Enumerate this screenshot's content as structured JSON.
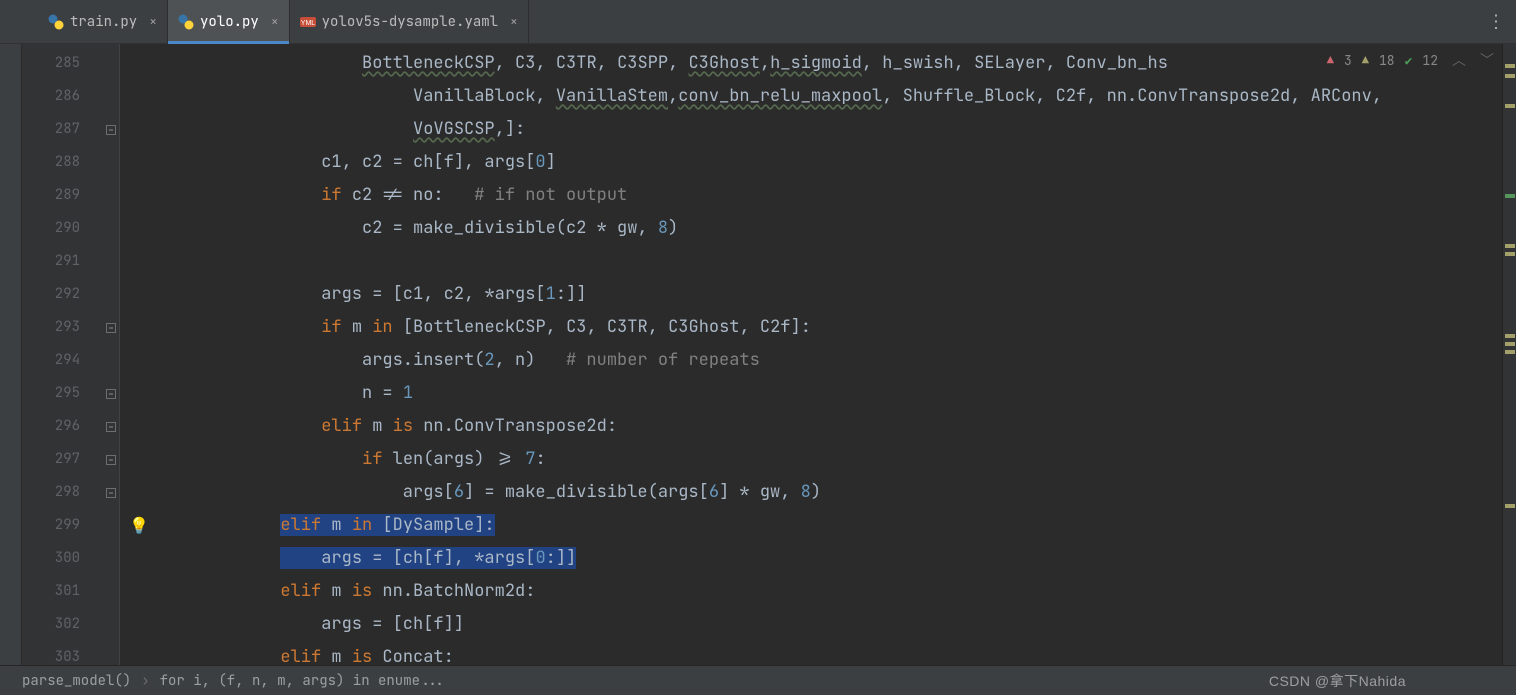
{
  "tabs": [
    {
      "label": "train.py",
      "type": "py"
    },
    {
      "label": "yolo.py",
      "type": "py"
    },
    {
      "label": "yolov5s-dysample.yaml",
      "type": "yaml"
    }
  ],
  "inspections": {
    "errors": "3",
    "warnings": "18",
    "ok": "12"
  },
  "lines_start": 285,
  "code": [
    {
      "n": 285,
      "fold": "",
      "segs": [
        [
          "        ",
          "id"
        ],
        [
          "BottleneckCSP",
          "wavy"
        ],
        [
          ", ",
          "id"
        ],
        [
          "C3",
          "id"
        ],
        [
          ", ",
          "id"
        ],
        [
          "C3TR",
          "id"
        ],
        [
          ", ",
          "id"
        ],
        [
          "C3SPP",
          "id"
        ],
        [
          ", ",
          "id"
        ],
        [
          "C3Ghost",
          "wavy"
        ],
        [
          ",",
          "id"
        ],
        [
          "h_sigmoid",
          "wavy"
        ],
        [
          ", h_swish, SELayer, Conv_bn_hs",
          "id"
        ]
      ]
    },
    {
      "n": 286,
      "fold": "",
      "segs": [
        [
          "             ",
          "id"
        ],
        [
          "VanillaBlock",
          "id"
        ],
        [
          ", ",
          "id"
        ],
        [
          "VanillaStem",
          "wavy"
        ],
        [
          ",",
          "id"
        ],
        [
          "conv_bn_relu_maxpool",
          "wavy"
        ],
        [
          ", Shuffle_Block, C2f, nn.ConvTranspose2d, ARConv, ",
          "id"
        ]
      ]
    },
    {
      "n": 287,
      "fold": "m",
      "segs": [
        [
          "             ",
          "id"
        ],
        [
          "VoVGSCSP",
          "wavy"
        ],
        [
          ",",
          "id"
        ],
        [
          "]:",
          "id"
        ]
      ]
    },
    {
      "n": 288,
      "fold": "",
      "segs": [
        [
          "    c1",
          "id"
        ],
        [
          ", ",
          "id"
        ],
        [
          "c2 = ch[f]",
          "id"
        ],
        [
          ", ",
          "id"
        ],
        [
          "args[",
          "id"
        ],
        [
          "0",
          "num"
        ],
        [
          "]",
          "id"
        ]
      ]
    },
    {
      "n": 289,
      "fold": "",
      "segs": [
        [
          "    ",
          "id"
        ],
        [
          "if ",
          "kw"
        ],
        [
          "c2 != no:   ",
          "id"
        ],
        [
          "# if not output",
          "cm"
        ]
      ]
    },
    {
      "n": 290,
      "fold": "",
      "segs": [
        [
          "        c2 = make_divisible(c2 * gw",
          "id"
        ],
        [
          ", ",
          "id"
        ],
        [
          "8",
          "num"
        ],
        [
          ")",
          "id"
        ]
      ]
    },
    {
      "n": 291,
      "fold": "",
      "segs": [
        [
          "",
          "id"
        ]
      ]
    },
    {
      "n": 292,
      "fold": "",
      "segs": [
        [
          "    args = [c1",
          "id"
        ],
        [
          ", ",
          "id"
        ],
        [
          "c2",
          "id"
        ],
        [
          ", ",
          "id"
        ],
        [
          "*args[",
          "id"
        ],
        [
          "1",
          "num"
        ],
        [
          ":]]",
          "id"
        ]
      ]
    },
    {
      "n": 293,
      "fold": "m",
      "segs": [
        [
          "    ",
          "id"
        ],
        [
          "if ",
          "kw"
        ],
        [
          "m ",
          "id"
        ],
        [
          "in ",
          "kw"
        ],
        [
          "[BottleneckCSP",
          "id"
        ],
        [
          ", ",
          "id"
        ],
        [
          "C3",
          "id"
        ],
        [
          ", ",
          "id"
        ],
        [
          "C3TR",
          "id"
        ],
        [
          ", ",
          "id"
        ],
        [
          "C3Ghost",
          "id"
        ],
        [
          ", ",
          "id"
        ],
        [
          "C2f]:",
          "id"
        ]
      ]
    },
    {
      "n": 294,
      "fold": "",
      "segs": [
        [
          "        args.insert(",
          "id"
        ],
        [
          "2",
          "num"
        ],
        [
          ", ",
          "id"
        ],
        [
          "n)   ",
          "id"
        ],
        [
          "# number of repeats",
          "cm"
        ]
      ]
    },
    {
      "n": 295,
      "fold": "m",
      "segs": [
        [
          "        n = ",
          "id"
        ],
        [
          "1",
          "num"
        ]
      ]
    },
    {
      "n": 296,
      "fold": "m",
      "segs": [
        [
          "    ",
          "id"
        ],
        [
          "elif ",
          "kw"
        ],
        [
          "m ",
          "id"
        ],
        [
          "is ",
          "kw"
        ],
        [
          "nn.ConvTranspose2d:",
          "id"
        ]
      ]
    },
    {
      "n": 297,
      "fold": "m",
      "segs": [
        [
          "        ",
          "id"
        ],
        [
          "if ",
          "kw"
        ],
        [
          "len(args) >= ",
          "id"
        ],
        [
          "7",
          "num"
        ],
        [
          ":",
          "id"
        ]
      ]
    },
    {
      "n": 298,
      "fold": "m",
      "segs": [
        [
          "            args[",
          "id"
        ],
        [
          "6",
          "num"
        ],
        [
          "] = make_divisible(args[",
          "id"
        ],
        [
          "6",
          "num"
        ],
        [
          "] * gw",
          "id"
        ],
        [
          ", ",
          "id"
        ],
        [
          "8",
          "num"
        ],
        [
          ")",
          "id"
        ]
      ]
    },
    {
      "n": 299,
      "fold": "",
      "sel": true,
      "bulb": true,
      "segs": [
        [
          "",
          "id"
        ],
        [
          "elif ",
          "kw sel"
        ],
        [
          "m ",
          "id sel"
        ],
        [
          "in ",
          "kw sel"
        ],
        [
          "[DySample]:",
          "id sel"
        ]
      ]
    },
    {
      "n": 300,
      "fold": "",
      "sel": true,
      "segs": [
        [
          "    ",
          "id sel"
        ],
        [
          "args = [ch[f]",
          "id sel"
        ],
        [
          ", ",
          "id sel"
        ],
        [
          "*args[",
          "id sel"
        ],
        [
          "0",
          "num sel"
        ],
        [
          ":]]",
          "id sel"
        ]
      ]
    },
    {
      "n": 301,
      "fold": "",
      "segs": [
        [
          "",
          "id"
        ],
        [
          "elif ",
          "kw"
        ],
        [
          "m ",
          "id"
        ],
        [
          "is ",
          "kw"
        ],
        [
          "nn.BatchNorm2d:",
          "id"
        ]
      ]
    },
    {
      "n": 302,
      "fold": "",
      "segs": [
        [
          "    args = [ch[f]]",
          "id"
        ]
      ]
    },
    {
      "n": 303,
      "fold": "",
      "segs": [
        [
          "",
          "id"
        ],
        [
          "elif ",
          "kw"
        ],
        [
          "m ",
          "id"
        ],
        [
          "is ",
          "kw"
        ],
        [
          "Concat:",
          "id"
        ]
      ]
    }
  ],
  "breadcrumbs": [
    "parse_model()",
    "for i, (f, n, m, args) in enume..."
  ],
  "watermark": "CSDN @拿下Nahida"
}
